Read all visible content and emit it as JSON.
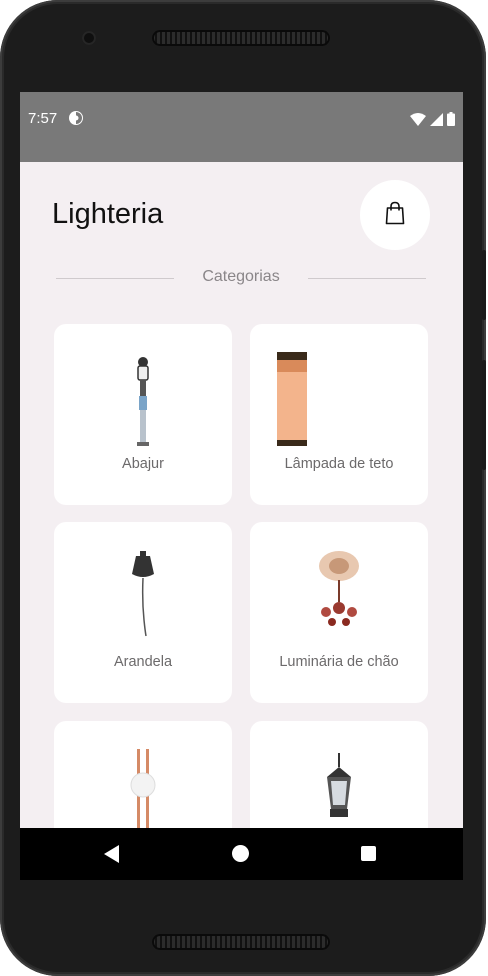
{
  "status_bar": {
    "time": "7:57",
    "app_icon": "notification-app-icon",
    "icons": [
      "wifi-icon",
      "cellular-signal-icon",
      "battery-icon"
    ]
  },
  "header": {
    "title": "Lighteria",
    "cart_icon": "shopping-bag-icon"
  },
  "section": {
    "label": "Categorias"
  },
  "categories": [
    {
      "label": "Abajur",
      "icon": "table-lamp-image"
    },
    {
      "label": "Lâmpada de teto",
      "icon": "ceiling-lamp-image"
    },
    {
      "label": "Arandela",
      "icon": "wall-sconce-image"
    },
    {
      "label": "Luminária de chão",
      "icon": "chandelier-image"
    },
    {
      "label": "",
      "icon": "floor-lamp-image"
    },
    {
      "label": "",
      "icon": "lantern-image"
    }
  ],
  "nav_bar": {
    "icons": [
      "back-icon",
      "home-icon",
      "recent-apps-icon"
    ]
  },
  "colors": {
    "background": "#f4eff2",
    "card": "#ffffff",
    "status_bar": "#797979",
    "nav_bar": "#000000",
    "title_text": "#111111",
    "secondary_text": "#8a8689"
  }
}
